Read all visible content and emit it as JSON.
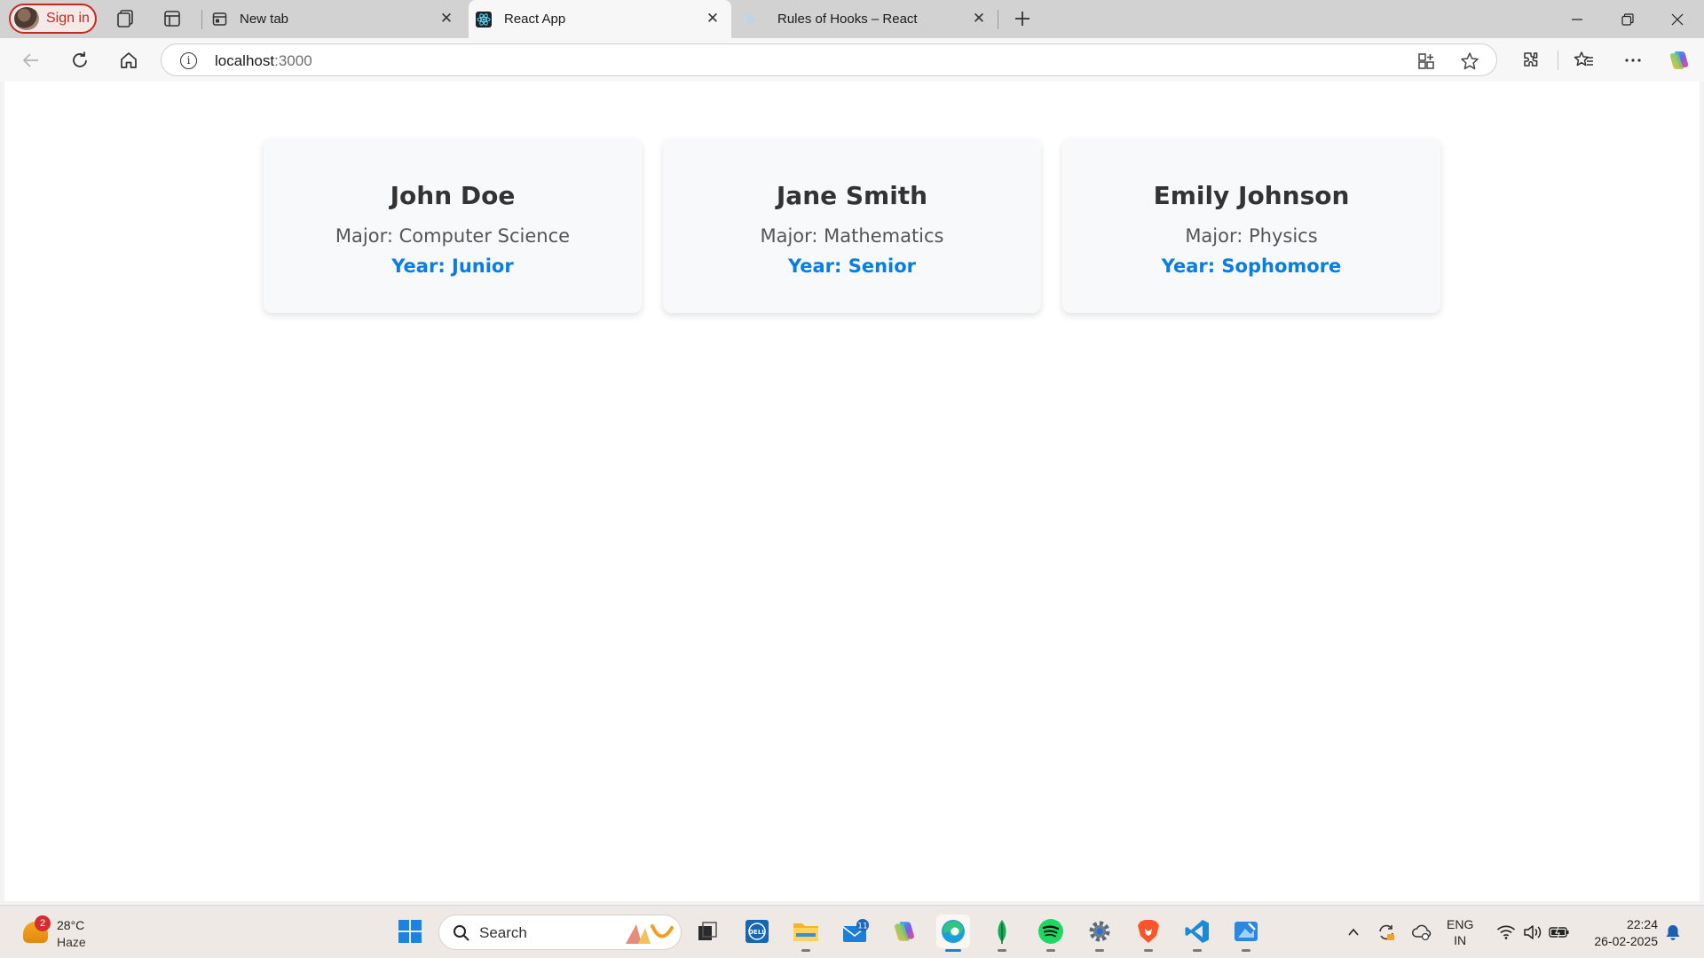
{
  "browser": {
    "signin_label": "Sign in",
    "tabs": [
      {
        "title": "New tab"
      },
      {
        "title": "React App"
      },
      {
        "title": "Rules of Hooks – React"
      }
    ],
    "address": {
      "host": "localhost",
      "port": ":3000"
    }
  },
  "page": {
    "students": [
      {
        "name": "John Doe",
        "major": "Major: Computer Science",
        "year": "Year: Junior"
      },
      {
        "name": "Jane Smith",
        "major": "Major: Mathematics",
        "year": "Year: Senior"
      },
      {
        "name": "Emily Johnson",
        "major": "Major: Physics",
        "year": "Year: Sophomore"
      }
    ],
    "colors": {
      "card_bg": "#f8f9fa",
      "name": "#333333",
      "major": "#555555",
      "year": "#0a7ee0"
    }
  },
  "taskbar": {
    "weather": {
      "badge": "2",
      "temp": "28°C",
      "condition": "Haze"
    },
    "search_label": "Search",
    "mail_badge": "11",
    "lang_top": "ENG",
    "lang_bottom": "IN",
    "time": "22:24",
    "date": "26-02-2025"
  }
}
